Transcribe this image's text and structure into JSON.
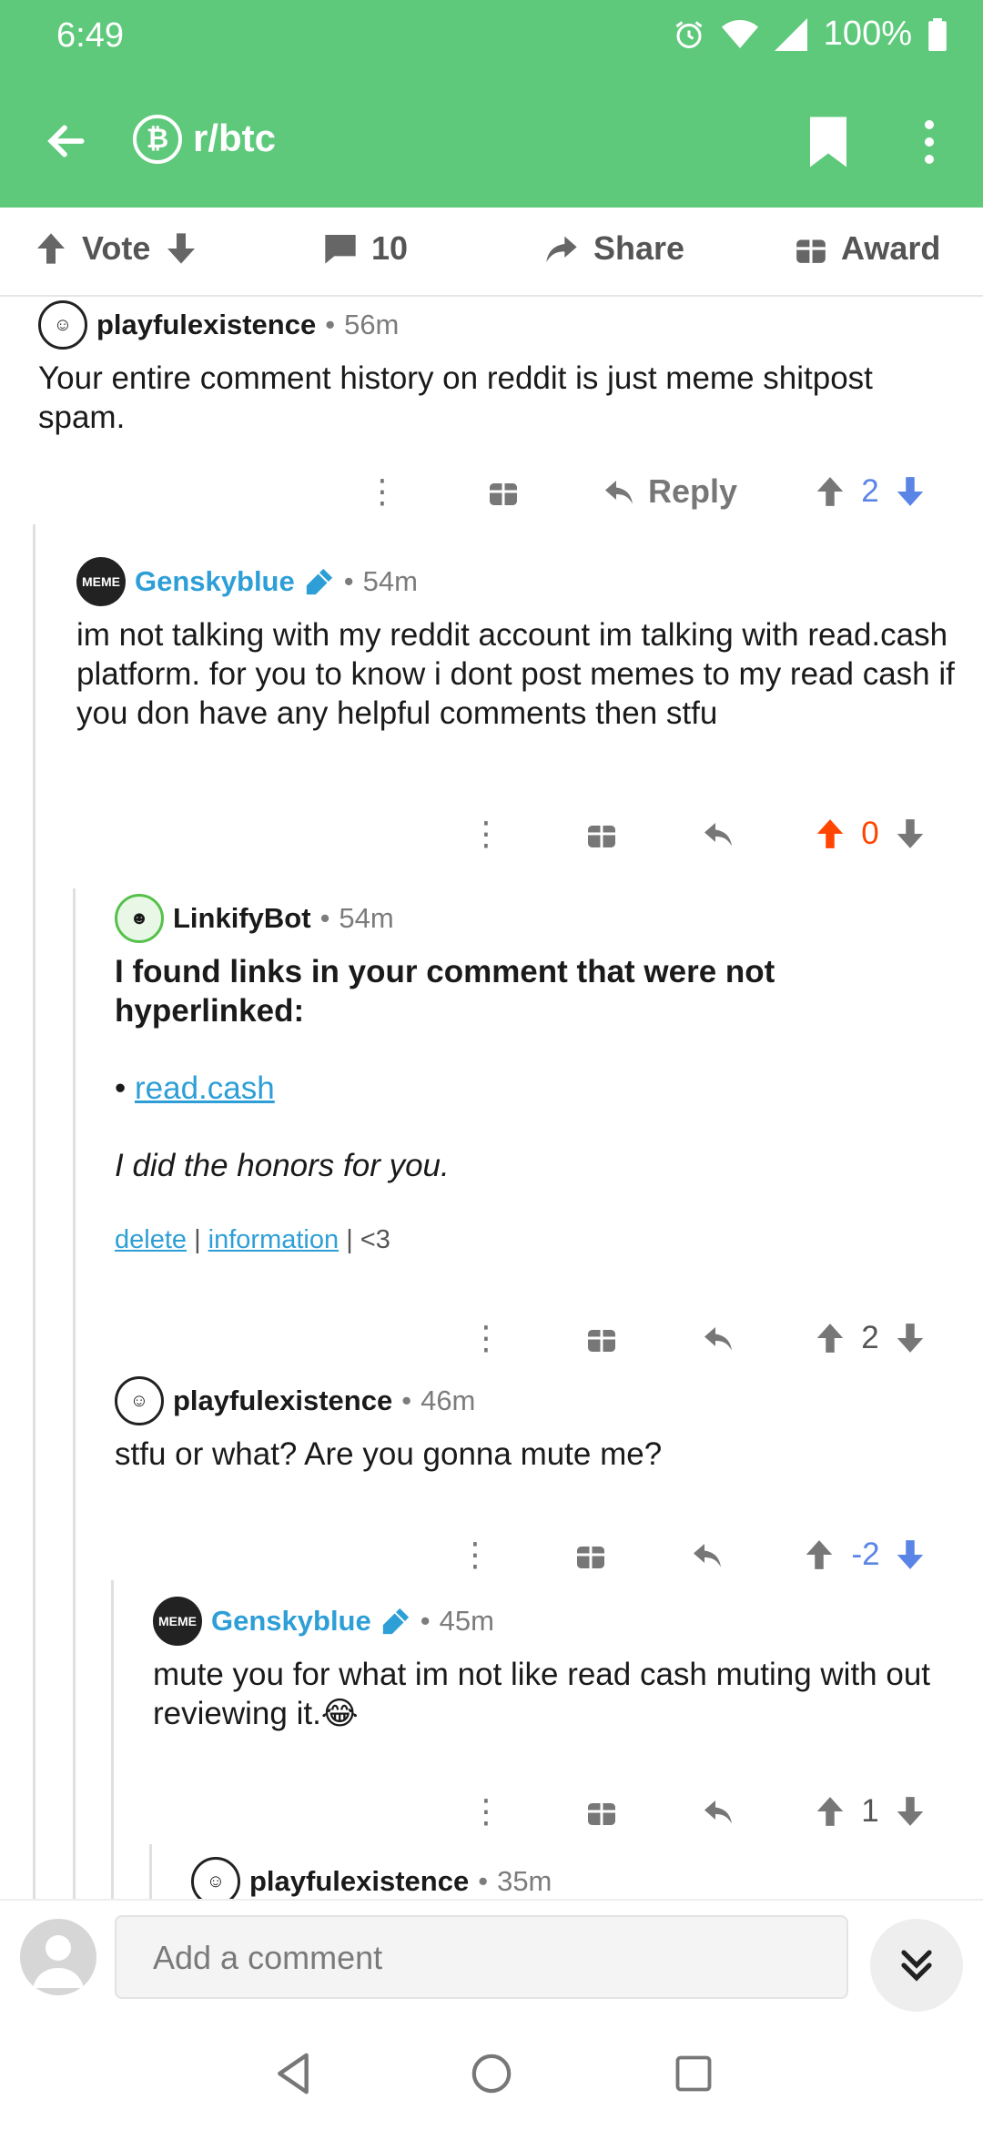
{
  "status": {
    "time": "6:49",
    "battery": "100%"
  },
  "toolbar": {
    "subreddit": "r/btc",
    "sub_icon": "bitcoin-icon"
  },
  "actionbar": {
    "vote": "Vote",
    "comments_count": "10",
    "share": "Share",
    "award": "Award"
  },
  "comments": [
    {
      "author": "playfulexistence",
      "time": "56m",
      "body": "Your entire comment history on reddit is just meme shitpost spam.",
      "reply_label": "Reply",
      "score": "2"
    },
    {
      "author": "Genskyblue",
      "time": "54m",
      "body": "im not talking with my reddit account im talking with read.cash platform. for you to know i dont post memes to my read cash if you don have any helpful comments then stfu",
      "score": "0"
    },
    {
      "author": "LinkifyBot",
      "time": "54m",
      "heading": "I found links in your comment that were not hyperlinked:",
      "bullet_link": "read.cash",
      "italic": "I did the honors for you.",
      "footer_delete": "delete",
      "footer_info": "information",
      "footer_heart": "<3",
      "score": "2"
    },
    {
      "author": "playfulexistence",
      "time": "46m",
      "body": "stfu or what? Are you gonna mute me?",
      "score": "-2"
    },
    {
      "author": "Genskyblue",
      "time": "45m",
      "body": "mute you for what im not like read cash muting with out reviewing it.",
      "emoji": "😂",
      "score": "1"
    },
    {
      "author": "playfulexistence",
      "time": "35m"
    }
  ],
  "compose": {
    "placeholder": "Add a comment"
  },
  "colors": {
    "header": "#5ec97b",
    "upvote": "#ff4500",
    "downvote": "#5a84e6",
    "link": "#2e9fd6"
  }
}
